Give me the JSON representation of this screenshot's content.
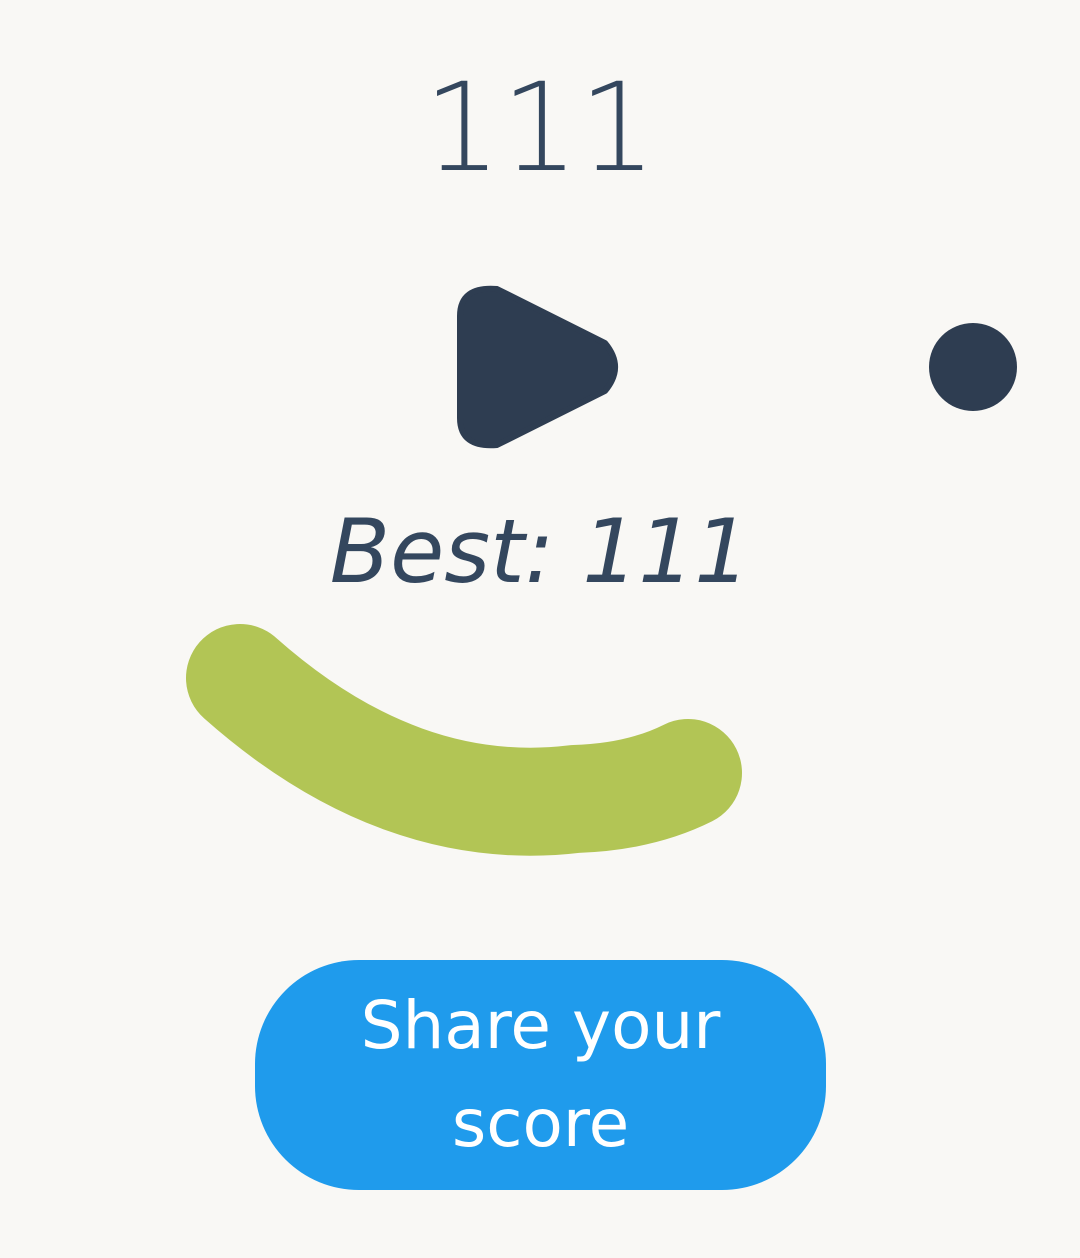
{
  "score": "111",
  "best": "Best: 111",
  "share_button": {
    "label": "Share your score"
  },
  "play_button": {
    "icon": "play-icon"
  },
  "colors": {
    "background": "#f9f8f5",
    "text": "#34475e",
    "dark_shape": "#2e3d51",
    "arc": "#b2c555",
    "button": "#1f9bec",
    "button_text": "#ffffff"
  }
}
